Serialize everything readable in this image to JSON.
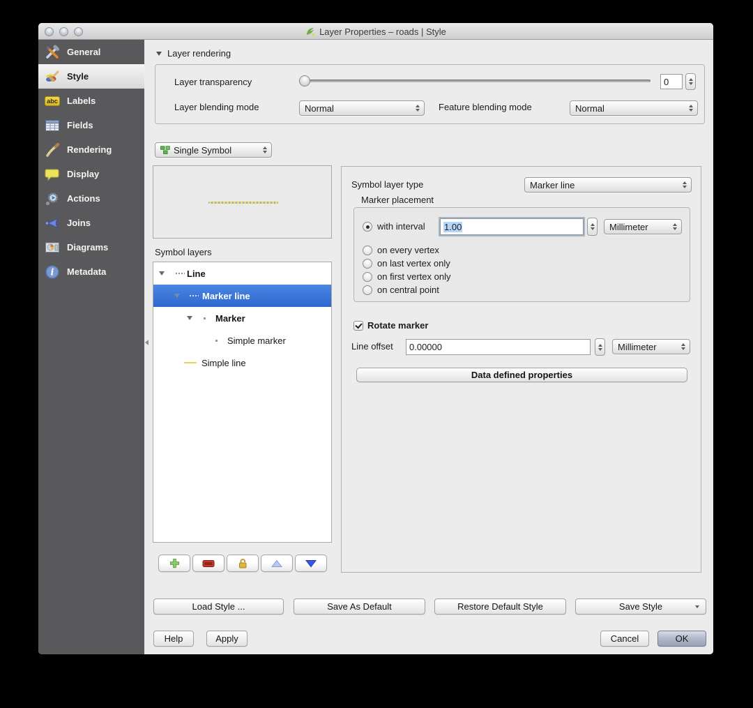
{
  "window": {
    "title": "Layer Properties – roads | Style"
  },
  "sidebar": {
    "items": [
      {
        "label": "General"
      },
      {
        "label": "Style",
        "selected": true
      },
      {
        "label": "Labels",
        "icon_text": "abc"
      },
      {
        "label": "Fields"
      },
      {
        "label": "Rendering"
      },
      {
        "label": "Display"
      },
      {
        "label": "Actions"
      },
      {
        "label": "Joins"
      },
      {
        "label": "Diagrams"
      },
      {
        "label": "Metadata"
      }
    ]
  },
  "layer_rendering": {
    "header": "Layer rendering",
    "transparency_label": "Layer transparency",
    "transparency_value": "0",
    "layer_blending_label": "Layer blending mode",
    "layer_blending_value": "Normal",
    "feature_blending_label": "Feature blending mode",
    "feature_blending_value": "Normal"
  },
  "renderer": {
    "value": "Single Symbol"
  },
  "symbol_layers": {
    "label": "Symbol layers",
    "tree": [
      {
        "label": "Line"
      },
      {
        "label": "Marker line",
        "selected": true
      },
      {
        "label": "Marker"
      },
      {
        "label": "Simple marker"
      },
      {
        "label": "Simple line"
      }
    ]
  },
  "symbol_properties": {
    "layer_type_label": "Symbol layer type",
    "layer_type_value": "Marker line",
    "marker_placement_label": "Marker placement",
    "with_interval_label": "with interval",
    "interval_value": "1.00",
    "interval_unit": "Millimeter",
    "placement_options": [
      "on every vertex",
      "on last vertex only",
      "on first vertex only",
      "on central point"
    ],
    "rotate_marker_label": "Rotate marker",
    "line_offset_label": "Line offset",
    "line_offset_value": "0.00000",
    "line_offset_unit": "Millimeter",
    "data_defined_button": "Data defined properties"
  },
  "style_actions": {
    "load_style": "Load Style ...",
    "save_as_default": "Save As Default",
    "restore_default": "Restore Default Style",
    "save_style": "Save Style"
  },
  "dialog_actions": {
    "help": "Help",
    "apply": "Apply",
    "cancel": "Cancel",
    "ok": "OK"
  },
  "colors": {
    "selection_blue": "#3875d7",
    "sidebar_gray": "#59595b",
    "symbol_yellow": "#e2d557"
  }
}
